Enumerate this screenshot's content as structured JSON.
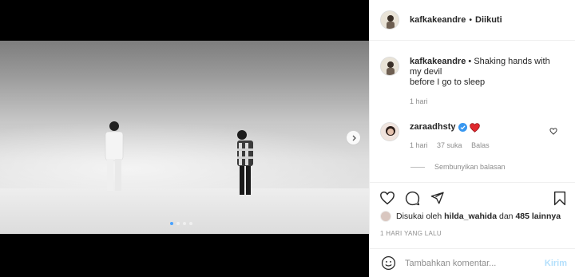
{
  "post": {
    "username": "kafkakeandre",
    "follow_status": "Diikuti",
    "separator": "•"
  },
  "caption": {
    "username": "kafkakeandre",
    "line1": "Shaking hands with my devil",
    "line2": "before I go to sleep",
    "time": "1 hari"
  },
  "comment": {
    "username": "zaraadhsty",
    "time": "1 hari",
    "likes": "37 suka",
    "reply": "Balas",
    "hide_replies": "Sembunyikan balasan"
  },
  "engagement": {
    "liked_by_prefix": "Disukai oleh",
    "liked_by_user": "hilda_wahida",
    "and_word": "dan",
    "others": "485 lainnya",
    "time_ago": "1 HARI YANG LALU"
  },
  "add_comment": {
    "placeholder": "Tambahkan komentar...",
    "submit": "Kirim"
  },
  "carousel": {
    "total": 4,
    "active": 1
  },
  "colors": {
    "verified": "#3897f0",
    "heart_red": "#ed4956",
    "submit_disabled": "#b2dffc"
  }
}
